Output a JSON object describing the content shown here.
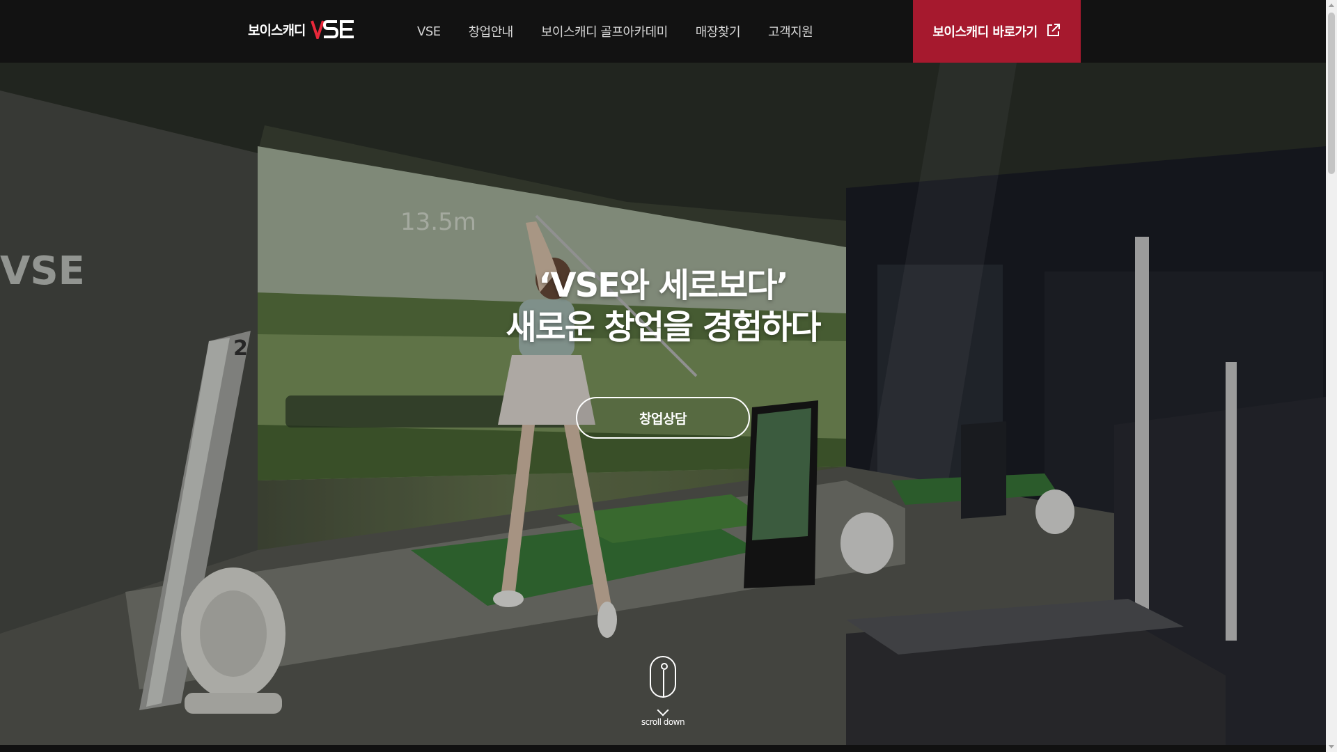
{
  "header": {
    "logo_text": "보이스캐디",
    "logo_mark": "VSE",
    "nav": [
      {
        "label": "VSE"
      },
      {
        "label": "창업안내"
      },
      {
        "label": "보이스캐디 골프아카데미"
      },
      {
        "label": "매장찾기"
      },
      {
        "label": "고객지원"
      }
    ],
    "cta_label": "보이스캐디 바로가기",
    "cta_icon": "external-link-icon",
    "cta_color": "#a6192e"
  },
  "hero": {
    "headline_line1": "‘VSE와 세로보다’",
    "headline_line2": "새로운 창업을 경험하다",
    "consult_button": "창업상담",
    "scroll_label": "scroll down",
    "screen_distance": "13.5m",
    "bay_number": "2",
    "wall_logo": "VSE"
  }
}
